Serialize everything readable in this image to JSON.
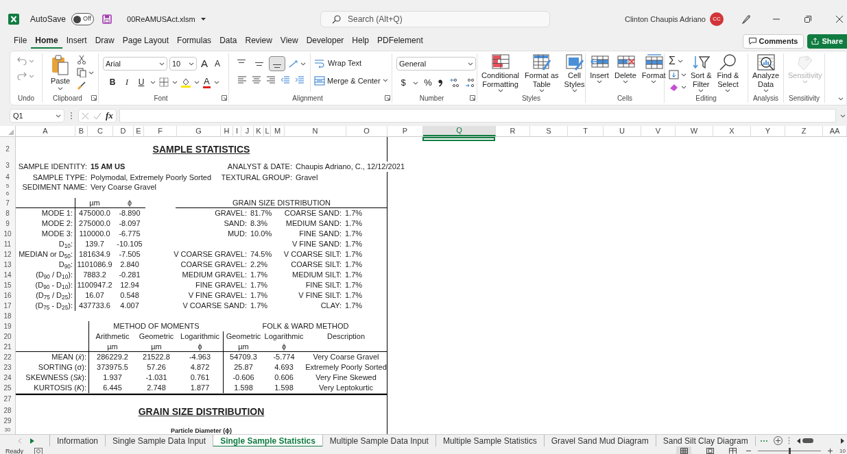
{
  "title_bar": {
    "autosave_label": "AutoSave",
    "autosave": {
      "on": false,
      "label": "Off"
    },
    "filename": "00ReAMUSAct.xlsm",
    "search": {
      "placeholder": "Search (Alt+Q)"
    },
    "user_name": "Clinton Chaupis Adriano",
    "avatar_initials": "CC"
  },
  "menu_tabs": [
    {
      "label": "File",
      "selected": false
    },
    {
      "label": "Home",
      "selected": true
    },
    {
      "label": "Insert",
      "selected": false
    },
    {
      "label": "Draw",
      "selected": false
    },
    {
      "label": "Page Layout",
      "selected": false
    },
    {
      "label": "Formulas",
      "selected": false
    },
    {
      "label": "Data",
      "selected": false
    },
    {
      "label": "Review",
      "selected": false
    },
    {
      "label": "View",
      "selected": false
    },
    {
      "label": "Developer",
      "selected": false
    },
    {
      "label": "Help",
      "selected": false
    },
    {
      "label": "PDFelement",
      "selected": false
    }
  ],
  "comments_button": "Comments",
  "share_button": "Share",
  "ribbon": [
    {
      "kind": "undo",
      "label": "Undo"
    },
    {
      "kind": "clipboard",
      "label": "Clipboard",
      "paste": "Paste"
    },
    {
      "kind": "font",
      "label": "Font",
      "font_name": "Arial",
      "font_size": "10",
      "grow": "A",
      "shrink": "A",
      "bold": "B",
      "italic": "I",
      "underline": "U",
      "font_color": "A"
    },
    {
      "kind": "alignment",
      "label": "Alignment",
      "valign": [
        {
          "selected": false
        },
        {
          "selected": false
        },
        {
          "selected": true
        }
      ],
      "wrap_text": "Wrap Text",
      "merge": "Merge & Center"
    },
    {
      "kind": "number",
      "label": "Number",
      "format": "General",
      "currency": "$",
      "percent": "%"
    },
    {
      "kind": "styles",
      "label": "Styles",
      "buttons": [
        {
          "lines": [
            "Conditional",
            "Formatting"
          ],
          "disabled": false
        },
        {
          "lines": [
            "Format as",
            "Table"
          ],
          "disabled": false
        },
        {
          "lines": [
            "Cell",
            "Styles"
          ],
          "disabled": false
        }
      ]
    },
    {
      "kind": "cells",
      "label": "Cells",
      "buttons": [
        {
          "lines": [
            "Insert"
          ],
          "disabled": false
        },
        {
          "lines": [
            "Delete"
          ],
          "disabled": false
        },
        {
          "lines": [
            "Format"
          ],
          "disabled": false
        }
      ]
    },
    {
      "kind": "editing",
      "label": "Editing",
      "sum": "Σ",
      "buttons": [
        {
          "lines": [
            "Sort &",
            "Filter"
          ],
          "disabled": false
        },
        {
          "lines": [
            "Find &",
            "Select"
          ],
          "disabled": false
        }
      ]
    },
    {
      "kind": "analysis",
      "label": "Analysis",
      "buttons": [
        {
          "lines": [
            "Analyze",
            "Data"
          ],
          "disabled": false
        }
      ]
    },
    {
      "kind": "sensitivity",
      "label": "Sensitivity",
      "buttons": [
        {
          "lines": [
            "Sensitivity"
          ],
          "disabled": true
        }
      ]
    }
  ],
  "formula_bar": {
    "name_box": "Q1",
    "fx": "fx"
  },
  "columns": [
    {
      "label": "A",
      "selected": false
    },
    {
      "label": "B",
      "selected": false
    },
    {
      "label": "C",
      "selected": false
    },
    {
      "label": "D",
      "selected": false
    },
    {
      "label": "E",
      "selected": false
    },
    {
      "label": "F",
      "selected": false
    },
    {
      "label": "G",
      "selected": false
    },
    {
      "label": "H",
      "selected": false
    },
    {
      "label": "I",
      "selected": false
    },
    {
      "label": "J",
      "selected": false
    },
    {
      "label": "K",
      "selected": false
    },
    {
      "label": "L",
      "selected": false
    },
    {
      "label": "M",
      "selected": false
    },
    {
      "label": "N",
      "selected": false
    },
    {
      "label": "O",
      "selected": false
    },
    {
      "label": "P",
      "selected": false
    },
    {
      "label": "Q",
      "selected": true
    },
    {
      "label": "R",
      "selected": false
    },
    {
      "label": "S",
      "selected": false
    },
    {
      "label": "T",
      "selected": false
    },
    {
      "label": "U",
      "selected": false
    },
    {
      "label": "V",
      "selected": false
    },
    {
      "label": "W",
      "selected": false
    },
    {
      "label": "X",
      "selected": false
    },
    {
      "label": "Y",
      "selected": false
    },
    {
      "label": "Z",
      "selected": false
    },
    {
      "label": "AA",
      "selected": false
    }
  ],
  "row_headers": [
    "2",
    "3",
    "4",
    "5",
    "6",
    "7",
    "8",
    "9",
    "10",
    "11",
    "12",
    "13",
    "14",
    "15",
    "16",
    "17",
    "18",
    "19",
    "20",
    "21",
    "22",
    "23",
    "24",
    "25",
    "27",
    "28",
    "29",
    "30"
  ],
  "report": {
    "title": "SAMPLE STATISTICS",
    "info_rows": [
      [
        {
          "label": "SAMPLE IDENTITY:",
          "value": "15 AM US",
          "bold": true
        },
        {
          "label": "ANALYST & DATE:",
          "value": "Chaupis Adriano, C., 12/12/2021",
          "bold": false
        }
      ],
      [
        {
          "label": "SAMPLE TYPE:",
          "value": "Polymodal, Extremely Poorly Sorted",
          "bold": false
        },
        {
          "label": "TEXTURAL GROUP:",
          "value": "Gravel",
          "bold": false
        }
      ],
      [
        {
          "label": "SEDIMENT NAME:",
          "value": "Very Coarse Gravel",
          "bold": false
        }
      ]
    ],
    "stats_headers": [
      "µm",
      "ϕ"
    ],
    "stats": [
      {
        "label": "MODE 1:",
        "um": "475000.0",
        "phi": "-8.890"
      },
      {
        "label": "MODE 2:",
        "um": "275000.0",
        "phi": "-8.097"
      },
      {
        "label": "MODE 3:",
        "um": "110000.0",
        "phi": "-6.775"
      },
      {
        "label": "D$_{10}$:",
        "um": "139.7",
        "phi": "-10.105"
      },
      {
        "label": "MEDIAN or D$_{50}$:",
        "um": "181634.9",
        "phi": "-7.505"
      },
      {
        "label": "D$_{90}$:",
        "um": "1101086.9",
        "phi": "2.840"
      },
      {
        "label": "(D$_{90}$ / D$_{10}$):",
        "um": "7883.2",
        "phi": "-0.281"
      },
      {
        "label": "(D$_{90}$ - D$_{10}$):",
        "um": "1100947.2",
        "phi": "12.94"
      },
      {
        "label": "(D$_{75}$ / D$_{25}$):",
        "um": "16.07",
        "phi": "0.548"
      },
      {
        "label": "(D$_{75}$ - D$_{25}$):",
        "um": "437733.6",
        "phi": "4.007"
      }
    ],
    "distribution_title": "GRAIN SIZE DISTRIBUTION",
    "distribution": [
      {
        "left_label": "GRAVEL:",
        "left_value": "81.7%",
        "right_label": "COARSE SAND:",
        "right_value": "1.7%"
      },
      {
        "left_label": "SAND:",
        "left_value": "8.3%",
        "right_label": "MEDIUM SAND:",
        "right_value": "1.7%"
      },
      {
        "left_label": "MUD:",
        "left_value": "10.0%",
        "right_label": "FINE SAND:",
        "right_value": "1.7%"
      },
      {
        "right_label": "V FINE SAND:",
        "right_value": "1.7%"
      },
      {
        "left_label": "V COARSE GRAVEL:",
        "left_value": "74.5%",
        "right_label": "V COARSE SILT:",
        "right_value": "1.7%"
      },
      {
        "left_label": "COARSE GRAVEL:",
        "left_value": "2.2%",
        "right_label": "COARSE SILT:",
        "right_value": "1.7%"
      },
      {
        "left_label": "MEDIUM GRAVEL:",
        "left_value": "1.7%",
        "right_label": "MEDIUM SILT:",
        "right_value": "1.7%"
      },
      {
        "left_label": "FINE GRAVEL:",
        "left_value": "1.7%",
        "right_label": "FINE SILT:",
        "right_value": "1.7%"
      },
      {
        "left_label": "V FINE GRAVEL:",
        "left_value": "1.7%",
        "right_label": "V FINE SILT:",
        "right_value": "1.7%"
      },
      {
        "left_label": "V COARSE SAND:",
        "left_value": "1.7%",
        "right_label": "CLAY:",
        "right_value": "1.7%"
      }
    ],
    "method_titles": [
      "METHOD OF MOMENTS",
      "FOLK & WARD METHOD"
    ],
    "method_columns": [
      {
        "name": "Arithmetic",
        "unit": "µm"
      },
      {
        "name": "Geometric",
        "unit": "µm"
      },
      {
        "name": "Logarithmic",
        "unit": "ϕ"
      },
      {
        "name": "Geometric",
        "unit": "µm"
      },
      {
        "name": "Logarithmic",
        "unit": "ϕ"
      },
      {
        "name": "Description"
      }
    ],
    "method_rows": [
      {
        "label": "MEAN (*x̄*):",
        "values": [
          "286229.2",
          "21522.8",
          "-4.963",
          "54709.3",
          "-5.774",
          "Very Coarse Gravel"
        ]
      },
      {
        "label": "SORTING (σ):",
        "values": [
          "373975.5",
          "57.26",
          "4.872",
          "25.87",
          "4.693",
          "Extremely Poorly Sorted"
        ]
      },
      {
        "label": "SKEWNESS (*Sk*):",
        "values": [
          "1.937",
          "-1.031",
          "0.761",
          "-0.606",
          "0.606",
          "Very Fine Skewed"
        ]
      },
      {
        "label": "KURTOSIS (*K*):",
        "values": [
          "6.445",
          "2.748",
          "1.877",
          "1.598",
          "1.598",
          "Very Leptokurtic"
        ]
      }
    ],
    "chart_title": "GRAIN SIZE DISTRIBUTION",
    "axis_title": "Particle Diameter (ϕ)"
  },
  "sheet_tabs": [
    {
      "label": "Information",
      "selected": false
    },
    {
      "label": "Single Sample Data Input",
      "selected": false
    },
    {
      "label": "Single Sample Statistics",
      "selected": true
    },
    {
      "label": "Multiple Sample Data Input",
      "selected": false
    },
    {
      "label": "Multiple Sample Statistics",
      "selected": false
    },
    {
      "label": "Gravel Sand Mud Diagram",
      "selected": false
    },
    {
      "label": "Sand Silt Clay Diagram",
      "selected": false
    }
  ],
  "status_bar": {
    "status": "Ready",
    "zoom": {
      "level": 0.5
    },
    "zoom_text": "10"
  }
}
